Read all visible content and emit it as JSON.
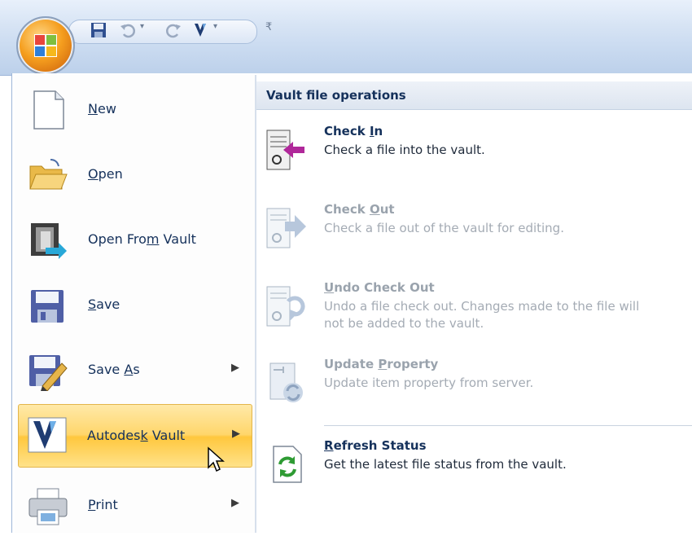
{
  "menu": {
    "items": [
      {
        "name": "New",
        "accel": "N",
        "rest": "ew",
        "icon": "new-document-icon",
        "submenu": false
      },
      {
        "name": "Open",
        "accel": "O",
        "rest": "pen",
        "icon": "open-folder-icon",
        "submenu": false
      },
      {
        "name": "Open From Vault",
        "pre": "Open Fro",
        "accel": "m",
        "post": " Vault",
        "icon": "open-from-vault-icon",
        "submenu": false
      },
      {
        "name": "Save",
        "accel": "S",
        "rest": "ave",
        "icon": "save-icon",
        "submenu": false
      },
      {
        "name": "Save As",
        "pre": "Save ",
        "accel": "A",
        "post": "s",
        "icon": "save-as-icon",
        "submenu": true
      },
      {
        "name": "Autodesk Vault",
        "pre": "Autodes",
        "accel": "k",
        "post": " Vault",
        "icon": "autodesk-vault-icon",
        "submenu": true,
        "selected": true
      },
      {
        "name": "Print",
        "accel": "P",
        "rest": "rint",
        "icon": "printer-icon",
        "submenu": true
      }
    ],
    "submenu_arrow": "▶"
  },
  "panel": {
    "header": "Vault file operations",
    "items": [
      {
        "pre": "Check ",
        "accel": "I",
        "post": "n",
        "desc": "Check a file into the vault.",
        "enabled": true,
        "icon": "check-in-icon"
      },
      {
        "pre": "Check ",
        "accel": "O",
        "post": "ut",
        "desc": "Check a file out of the vault for editing.",
        "enabled": false,
        "icon": "check-out-icon"
      },
      {
        "pre": "",
        "accel": "U",
        "post": "ndo Check Out",
        "desc": "Undo a file check out.  Changes made to the file will not be added to the vault.",
        "enabled": false,
        "icon": "undo-check-out-icon"
      },
      {
        "pre": "Update ",
        "accel": "P",
        "post": "roperty",
        "desc": "Update item property from server.",
        "enabled": false,
        "icon": "update-property-icon"
      },
      {
        "pre": "",
        "accel": "R",
        "post": "efresh Status",
        "desc": "Get the latest file status from the vault.",
        "enabled": true,
        "icon": "refresh-status-icon"
      }
    ]
  },
  "qat": {
    "icons": [
      "save-icon",
      "undo-icon",
      "redo-icon",
      "vault-icon",
      "customize-dropdown-icon"
    ],
    "dropdown_glyph": "▾",
    "customize_glyph": "₹"
  },
  "colors": {
    "accent": "#15315b",
    "selected": "#ffd66b",
    "disabled": "#9aa3ad"
  }
}
